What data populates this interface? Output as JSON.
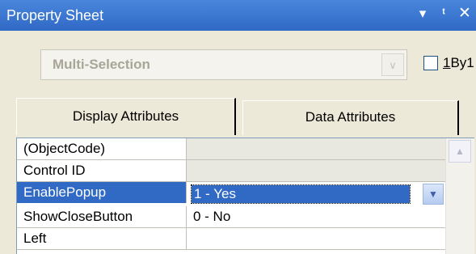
{
  "panel": {
    "title": "Property Sheet",
    "title_icons": [
      "dropdown-arrow-icon",
      "pin-icon",
      "close-icon"
    ]
  },
  "selector": {
    "value": "Multi-Selection",
    "disabled": true
  },
  "option": {
    "label": "1By1",
    "checked": false
  },
  "tabs": [
    {
      "label": "Display Attributes",
      "active": true
    },
    {
      "label": "Data Attributes",
      "active": false
    }
  ],
  "properties": [
    {
      "name": "(ObjectCode)",
      "value": ""
    },
    {
      "name": "Control ID",
      "value": ""
    },
    {
      "name": "EnablePopup",
      "value": "1 - Yes"
    },
    {
      "name": "ShowCloseButton",
      "value": "0 - No"
    },
    {
      "name": "Left",
      "value": ""
    }
  ],
  "colors": {
    "title_bar": "#3b78d1",
    "selection": "#316ac5",
    "panel_bg": "#ece9d8"
  }
}
